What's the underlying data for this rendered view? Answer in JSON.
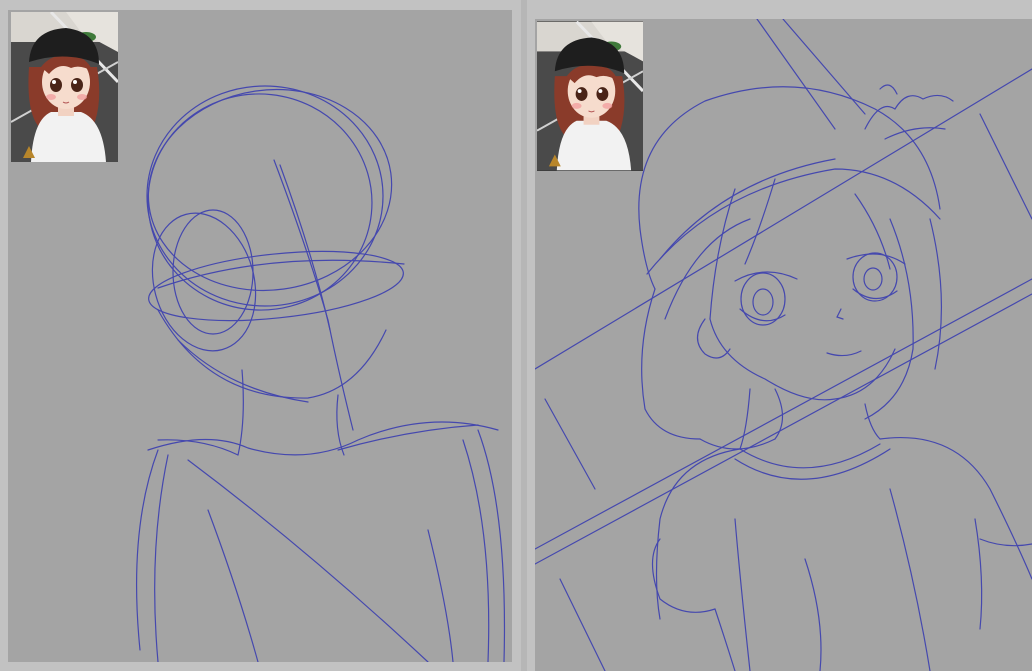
{
  "panels": [
    {
      "id": "rough-sketch",
      "reference_thumbnail": "anime-girl-reference"
    },
    {
      "id": "line-sketch",
      "reference_thumbnail": "anime-girl-reference"
    }
  ],
  "colors": {
    "background": "#c2c2c2",
    "canvas": "#a4a4a4",
    "sketch_line": "#3b3fb0",
    "hair": "#8a3b2a",
    "hat": "#1e1e1e",
    "shirt": "#f2f2f2",
    "skin": "#f6dccd"
  }
}
